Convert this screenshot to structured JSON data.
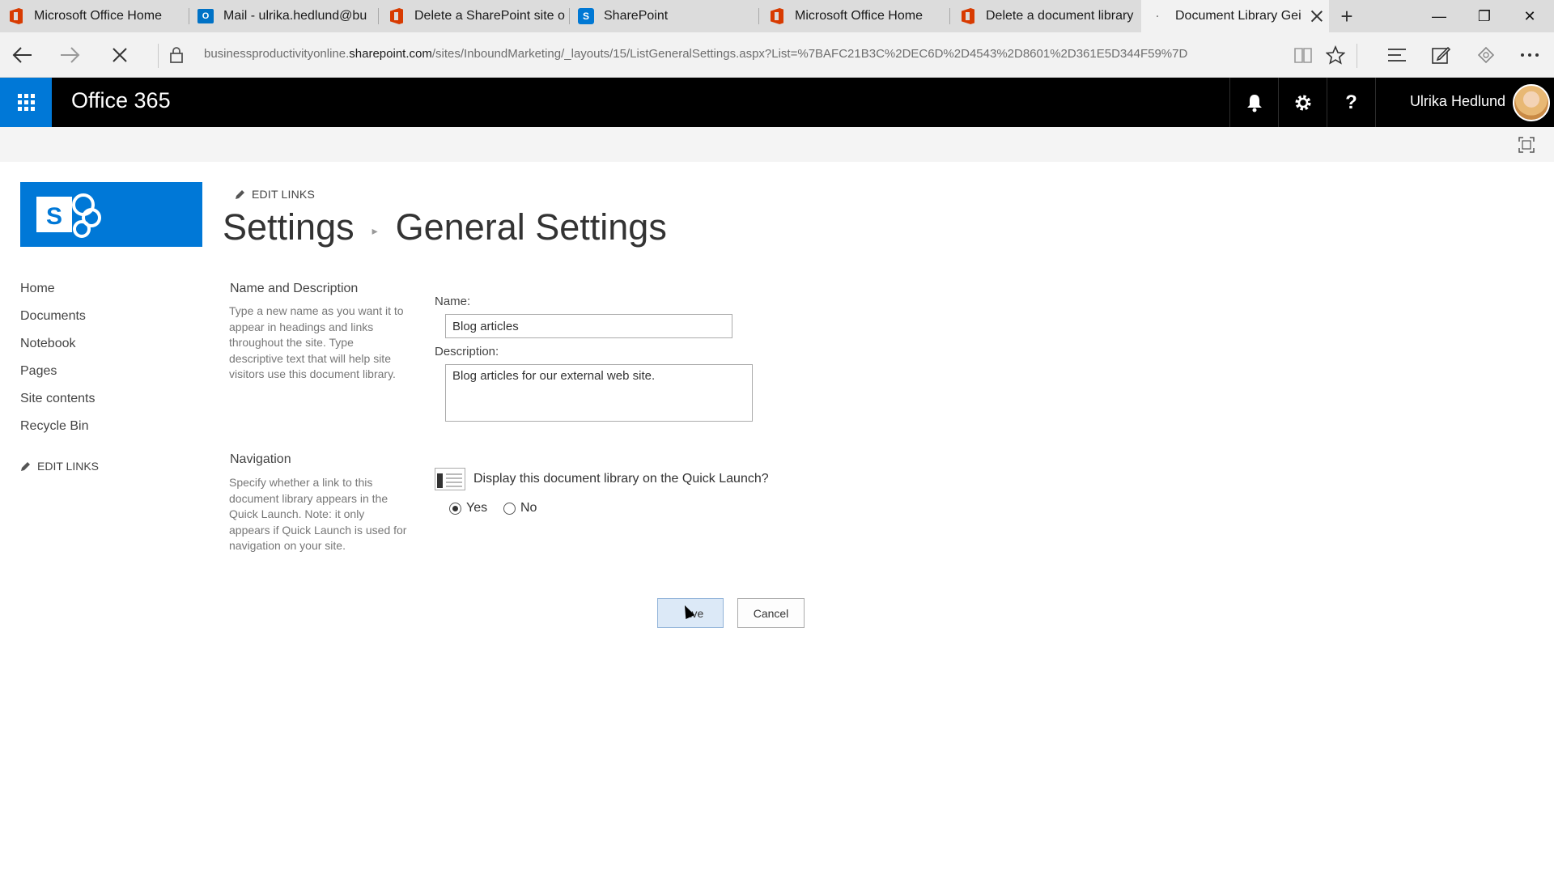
{
  "browser": {
    "tabs": [
      {
        "title": "Microsoft Office Home",
        "icon": "office-icon"
      },
      {
        "title": "Mail - ulrika.hedlund@bu",
        "icon": "outlook-icon"
      },
      {
        "title": "Delete a SharePoint site o",
        "icon": "office-icon"
      },
      {
        "title": "SharePoint",
        "icon": "sharepoint-icon"
      },
      {
        "title": "Microsoft Office Home",
        "icon": "office-icon"
      },
      {
        "title": "Delete a document library",
        "icon": "office-icon"
      },
      {
        "title": "Document Library Gei",
        "icon": "loading-icon",
        "active": true
      }
    ],
    "new_tab_symbol": "+",
    "window_controls": {
      "minimize": "—",
      "restore": "❐",
      "close": "✕"
    },
    "url_prefix": "businessproductivityonline.",
    "url_domain": "sharepoint.com",
    "url_path": "/sites/InboundMarketing/_layouts/15/ListGeneralSettings.aspx?List=%7BAFC21B3C%2DEC6D%2D4543%2D8601%2D361E5D344F59%7D"
  },
  "suitebar": {
    "brand": "Office 365",
    "user_name": "Ulrika Hedlund"
  },
  "site": {
    "logo_letter": "S",
    "edit_links": "EDIT LINKS",
    "breadcrumb_root": "Settings",
    "breadcrumb_current": "General Settings",
    "quick_launch": [
      "Home",
      "Documents",
      "Notebook",
      "Pages",
      "Site contents",
      "Recycle Bin"
    ],
    "quick_launch_edit": "EDIT LINKS"
  },
  "form": {
    "name_section": {
      "title": "Name and Description",
      "description": "Type a new name as you want it to appear in headings and links throughout the site. Type descriptive text that will help site visitors use this document library."
    },
    "name_label": "Name:",
    "name_value": "Blog articles",
    "description_label": "Description:",
    "description_value": "Blog articles for our external web site.",
    "nav_section": {
      "title": "Navigation",
      "description": "Specify whether a link to this document library appears in the Quick Launch. Note: it only appears if Quick Launch is used for navigation on your site."
    },
    "quick_launch_question": "Display this document library on the Quick Launch?",
    "option_yes": "Yes",
    "option_no": "No",
    "selected_option": "Yes",
    "save_label": "Save",
    "save_label_visible": "ave",
    "cancel_label": "Cancel"
  },
  "colors": {
    "suitebar_bg": "#000000",
    "accent": "#0078d7",
    "tab_bg": "#dcdcdc",
    "active_tab_bg": "#f2f2f2",
    "save_bg": "#dce9f7"
  }
}
